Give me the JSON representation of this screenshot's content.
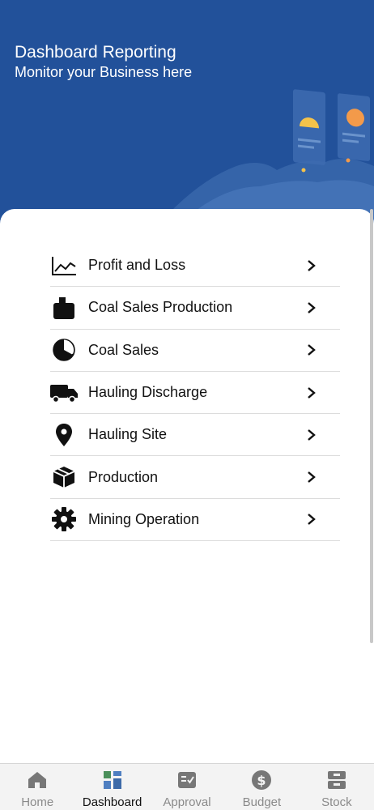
{
  "header": {
    "title": "Dashboard Reporting",
    "subtitle": "Monitor your Business here",
    "background_color": "#22519a"
  },
  "menu": {
    "items": [
      {
        "label": "Profit and Loss",
        "icon": "line-chart-icon"
      },
      {
        "label": "Coal Sales Production",
        "icon": "cart-icon"
      },
      {
        "label": "Coal Sales",
        "icon": "pie-chart-icon"
      },
      {
        "label": "Hauling Discharge",
        "icon": "truck-icon"
      },
      {
        "label": "Hauling Site",
        "icon": "map-pin-icon"
      },
      {
        "label": "Production",
        "icon": "box-icon"
      },
      {
        "label": "Mining Operation",
        "icon": "gear-icon"
      }
    ]
  },
  "tabbar": {
    "active": "Dashboard",
    "tabs": [
      {
        "label": "Home",
        "icon": "home-icon"
      },
      {
        "label": "Dashboard",
        "icon": "dashboard-icon"
      },
      {
        "label": "Approval",
        "icon": "approval-icon"
      },
      {
        "label": "Budget",
        "icon": "dollar-icon"
      },
      {
        "label": "Stock",
        "icon": "stock-icon"
      }
    ]
  }
}
